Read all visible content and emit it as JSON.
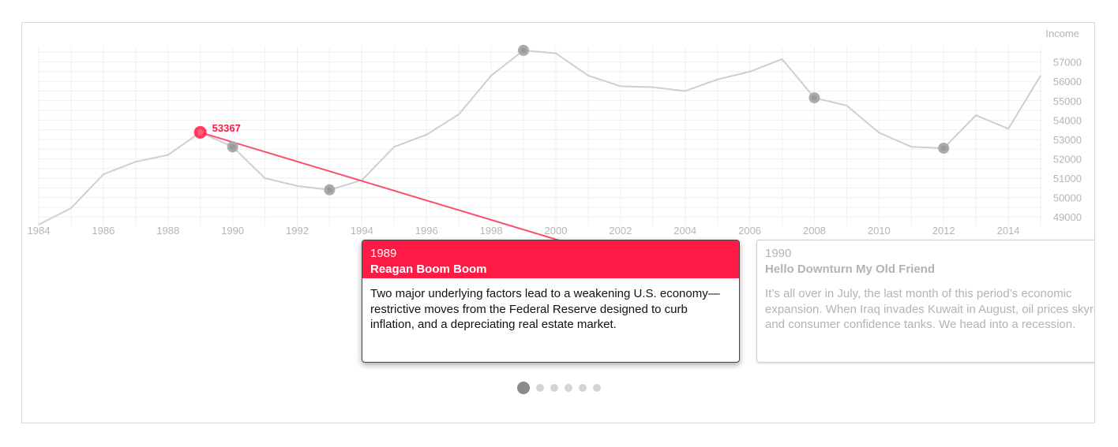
{
  "chart_data": {
    "type": "line",
    "ylabel": "Income",
    "x": [
      1984,
      1985,
      1986,
      1987,
      1988,
      1989,
      1990,
      1991,
      1992,
      1993,
      1994,
      1995,
      1996,
      1997,
      1998,
      1999,
      2000,
      2001,
      2002,
      2003,
      2004,
      2005,
      2006,
      2007,
      2008,
      2009,
      2010,
      2011,
      2012,
      2013,
      2014,
      2015
    ],
    "values": [
      48600,
      49450,
      51200,
      51850,
      52200,
      53367,
      52620,
      51000,
      50600,
      50400,
      50900,
      52620,
      53250,
      54300,
      56300,
      57600,
      57450,
      56300,
      55750,
      55700,
      55500,
      56100,
      56500,
      57150,
      55150,
      54750,
      53350,
      52620,
      52550,
      54250,
      53550,
      56300
    ],
    "xlim": [
      1984,
      2015
    ],
    "ylim": [
      48600,
      57800
    ],
    "xticks": [
      1984,
      1986,
      1988,
      1990,
      1992,
      1994,
      1996,
      1998,
      2000,
      2002,
      2004,
      2006,
      2008,
      2010,
      2012,
      2014
    ],
    "yticks": [
      49000,
      50000,
      51000,
      52000,
      53000,
      54000,
      55000,
      56000,
      57000
    ],
    "grid": true,
    "highlighted_points": [
      1989,
      1990,
      1993,
      1999,
      2008,
      2012
    ],
    "active_point": {
      "year": 1989,
      "value": 53367,
      "label": "53367"
    }
  },
  "colors": {
    "accent": "#ff1a45",
    "line": "#cfcfcf",
    "marker": "#aaaaaa"
  },
  "cards": [
    {
      "year": "1989",
      "title": "Reagan Boom Boom",
      "body": "Two major underlying factors lead to a weakening U.S. economy—restrictive moves from the Federal Reserve designed to curb inflation, and a depreciating real estate market."
    },
    {
      "year": "1990",
      "title": "Hello Downturn My Old Friend",
      "body_lines": [
        "It’s all over in July, the last month of this period’s economic",
        "expansion. When Iraq invades Kuwait in August, oil prices skyrocket",
        "and consumer confidence tanks. We head into a recession."
      ]
    }
  ],
  "pagination": {
    "count": 6,
    "active_index": 0
  }
}
